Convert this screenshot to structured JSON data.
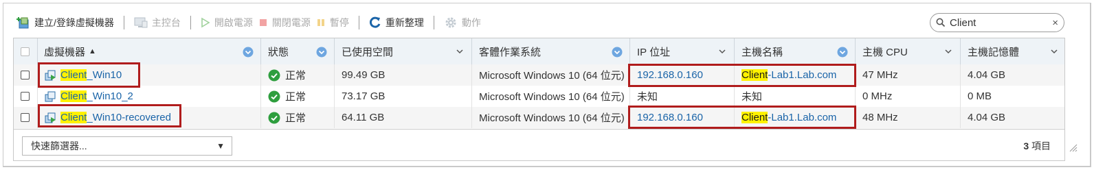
{
  "toolbar": {
    "create": "建立/登錄虛擬機器",
    "console": "主控台",
    "power_on": "開啟電源",
    "power_off": "關閉電源",
    "pause": "暫停",
    "refresh": "重新整理",
    "actions": "動作"
  },
  "search": {
    "value": "Client",
    "clear": "×"
  },
  "columns": [
    {
      "label": "虛擬機器",
      "sort": "▲"
    },
    {
      "label": "狀態"
    },
    {
      "label": "已使用空間"
    },
    {
      "label": "客體作業系統"
    },
    {
      "label": "IP 位址"
    },
    {
      "label": "主機名稱"
    },
    {
      "label": "主機 CPU"
    },
    {
      "label": "主機記憶體"
    }
  ],
  "rows": [
    {
      "name_hl": "Client",
      "name_rest": "_Win10",
      "status": "正常",
      "space": "99.49 GB",
      "os": "Microsoft Windows 10 (64 位元)",
      "ip": "192.168.0.160",
      "host_hl": "Client",
      "host_rest": "-Lab1.Lab.com",
      "cpu": "47 MHz",
      "mem": "4.04 GB"
    },
    {
      "name_hl": "Client",
      "name_rest": "_Win10_2",
      "status": "正常",
      "space": "73.17 GB",
      "os": "Microsoft Windows 10 (64 位元)",
      "ip": "未知",
      "host_plain": "未知",
      "cpu": "0 MHz",
      "mem": "0 MB"
    },
    {
      "name_hl": "Client",
      "name_rest": "_Win10-recovered",
      "status": "正常",
      "space": "64.11 GB",
      "os": "Microsoft Windows 10 (64 位元)",
      "ip": "192.168.0.160",
      "host_hl": "Client",
      "host_rest": "-Lab1.Lab.com",
      "cpu": "48 MHz",
      "mem": "4.04 GB"
    }
  ],
  "footer": {
    "quick_filter": "快速篩選器...",
    "dropdown": "▼",
    "count": "3",
    "count_unit": " 項目"
  },
  "colors": {
    "accent": "#1a64a8",
    "highlight": "#fff200",
    "annotation": "#b01c1c",
    "ok": "#2e9e3e"
  }
}
